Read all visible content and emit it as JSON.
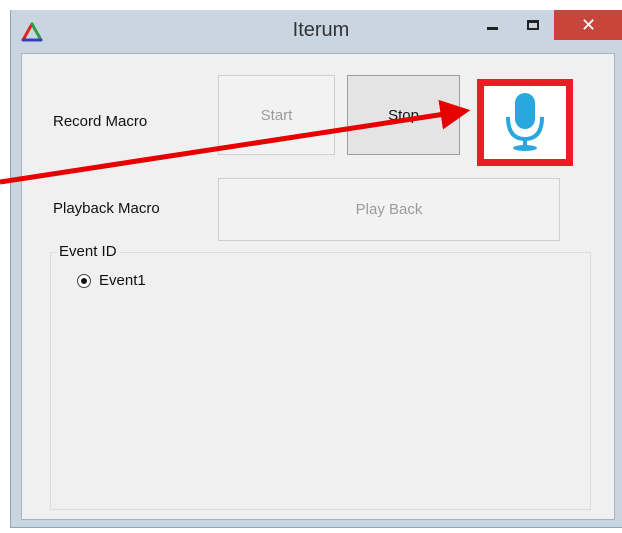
{
  "window": {
    "title": "Iterum",
    "close_glyph": "✕"
  },
  "record": {
    "label": "Record Macro",
    "start_label": "Start",
    "stop_label": "Stop",
    "mic_icon": "microphone-icon"
  },
  "playback": {
    "label": "Playback Macro",
    "button_label": "Play Back"
  },
  "events": {
    "group_label": "Event ID",
    "items": [
      {
        "label": "Event1",
        "selected": true
      }
    ]
  },
  "colors": {
    "titlebar": "#c9d6e2",
    "close": "#c7453b",
    "highlight": "#ec1c24",
    "mic": "#29a8e0"
  }
}
